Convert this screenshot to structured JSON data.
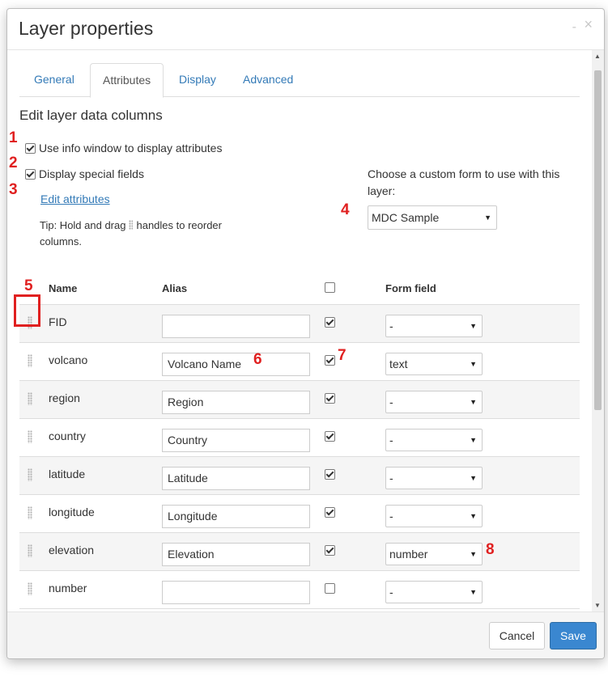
{
  "dialog": {
    "title": "Layer properties",
    "minimize_label": "-",
    "close_label": "×"
  },
  "tabs": [
    {
      "label": "General",
      "active": false
    },
    {
      "label": "Attributes",
      "active": true
    },
    {
      "label": "Display",
      "active": false
    },
    {
      "label": "Advanced",
      "active": false
    }
  ],
  "section": {
    "heading": "Edit layer data columns",
    "use_info_window": {
      "label": "Use info window to display attributes",
      "checked": true
    },
    "display_special": {
      "label": "Display special fields",
      "checked": true
    },
    "edit_attributes_link": "Edit attributes",
    "tip_before": "Tip: Hold and drag",
    "tip_after": "handles to reorder columns.",
    "custom_form_label": "Choose a custom form to use with this layer:",
    "custom_form_value": "MDC Sample"
  },
  "table": {
    "headers": {
      "name": "Name",
      "alias": "Alias",
      "form_field": "Form field"
    },
    "header_checkbox": false,
    "rows": [
      {
        "name": "FID",
        "alias": "",
        "visible": true,
        "form_field": "-"
      },
      {
        "name": "volcano",
        "alias": "Volcano Name",
        "visible": true,
        "form_field": "text"
      },
      {
        "name": "region",
        "alias": "Region",
        "visible": true,
        "form_field": "-"
      },
      {
        "name": "country",
        "alias": "Country",
        "visible": true,
        "form_field": "-"
      },
      {
        "name": "latitude",
        "alias": "Latitude",
        "visible": true,
        "form_field": "-"
      },
      {
        "name": "longitude",
        "alias": "Longitude",
        "visible": true,
        "form_field": "-"
      },
      {
        "name": "elevation",
        "alias": "Elevation",
        "visible": true,
        "form_field": "number"
      },
      {
        "name": "number",
        "alias": "",
        "visible": false,
        "form_field": "-"
      }
    ]
  },
  "markers": [
    "1",
    "2",
    "3",
    "4",
    "5",
    "6",
    "7",
    "8"
  ],
  "footer": {
    "cancel_label": "Cancel",
    "save_label": "Save"
  },
  "colors": {
    "accent": "#3a87d0",
    "link": "#337ab7",
    "annotation": "#e02020"
  }
}
